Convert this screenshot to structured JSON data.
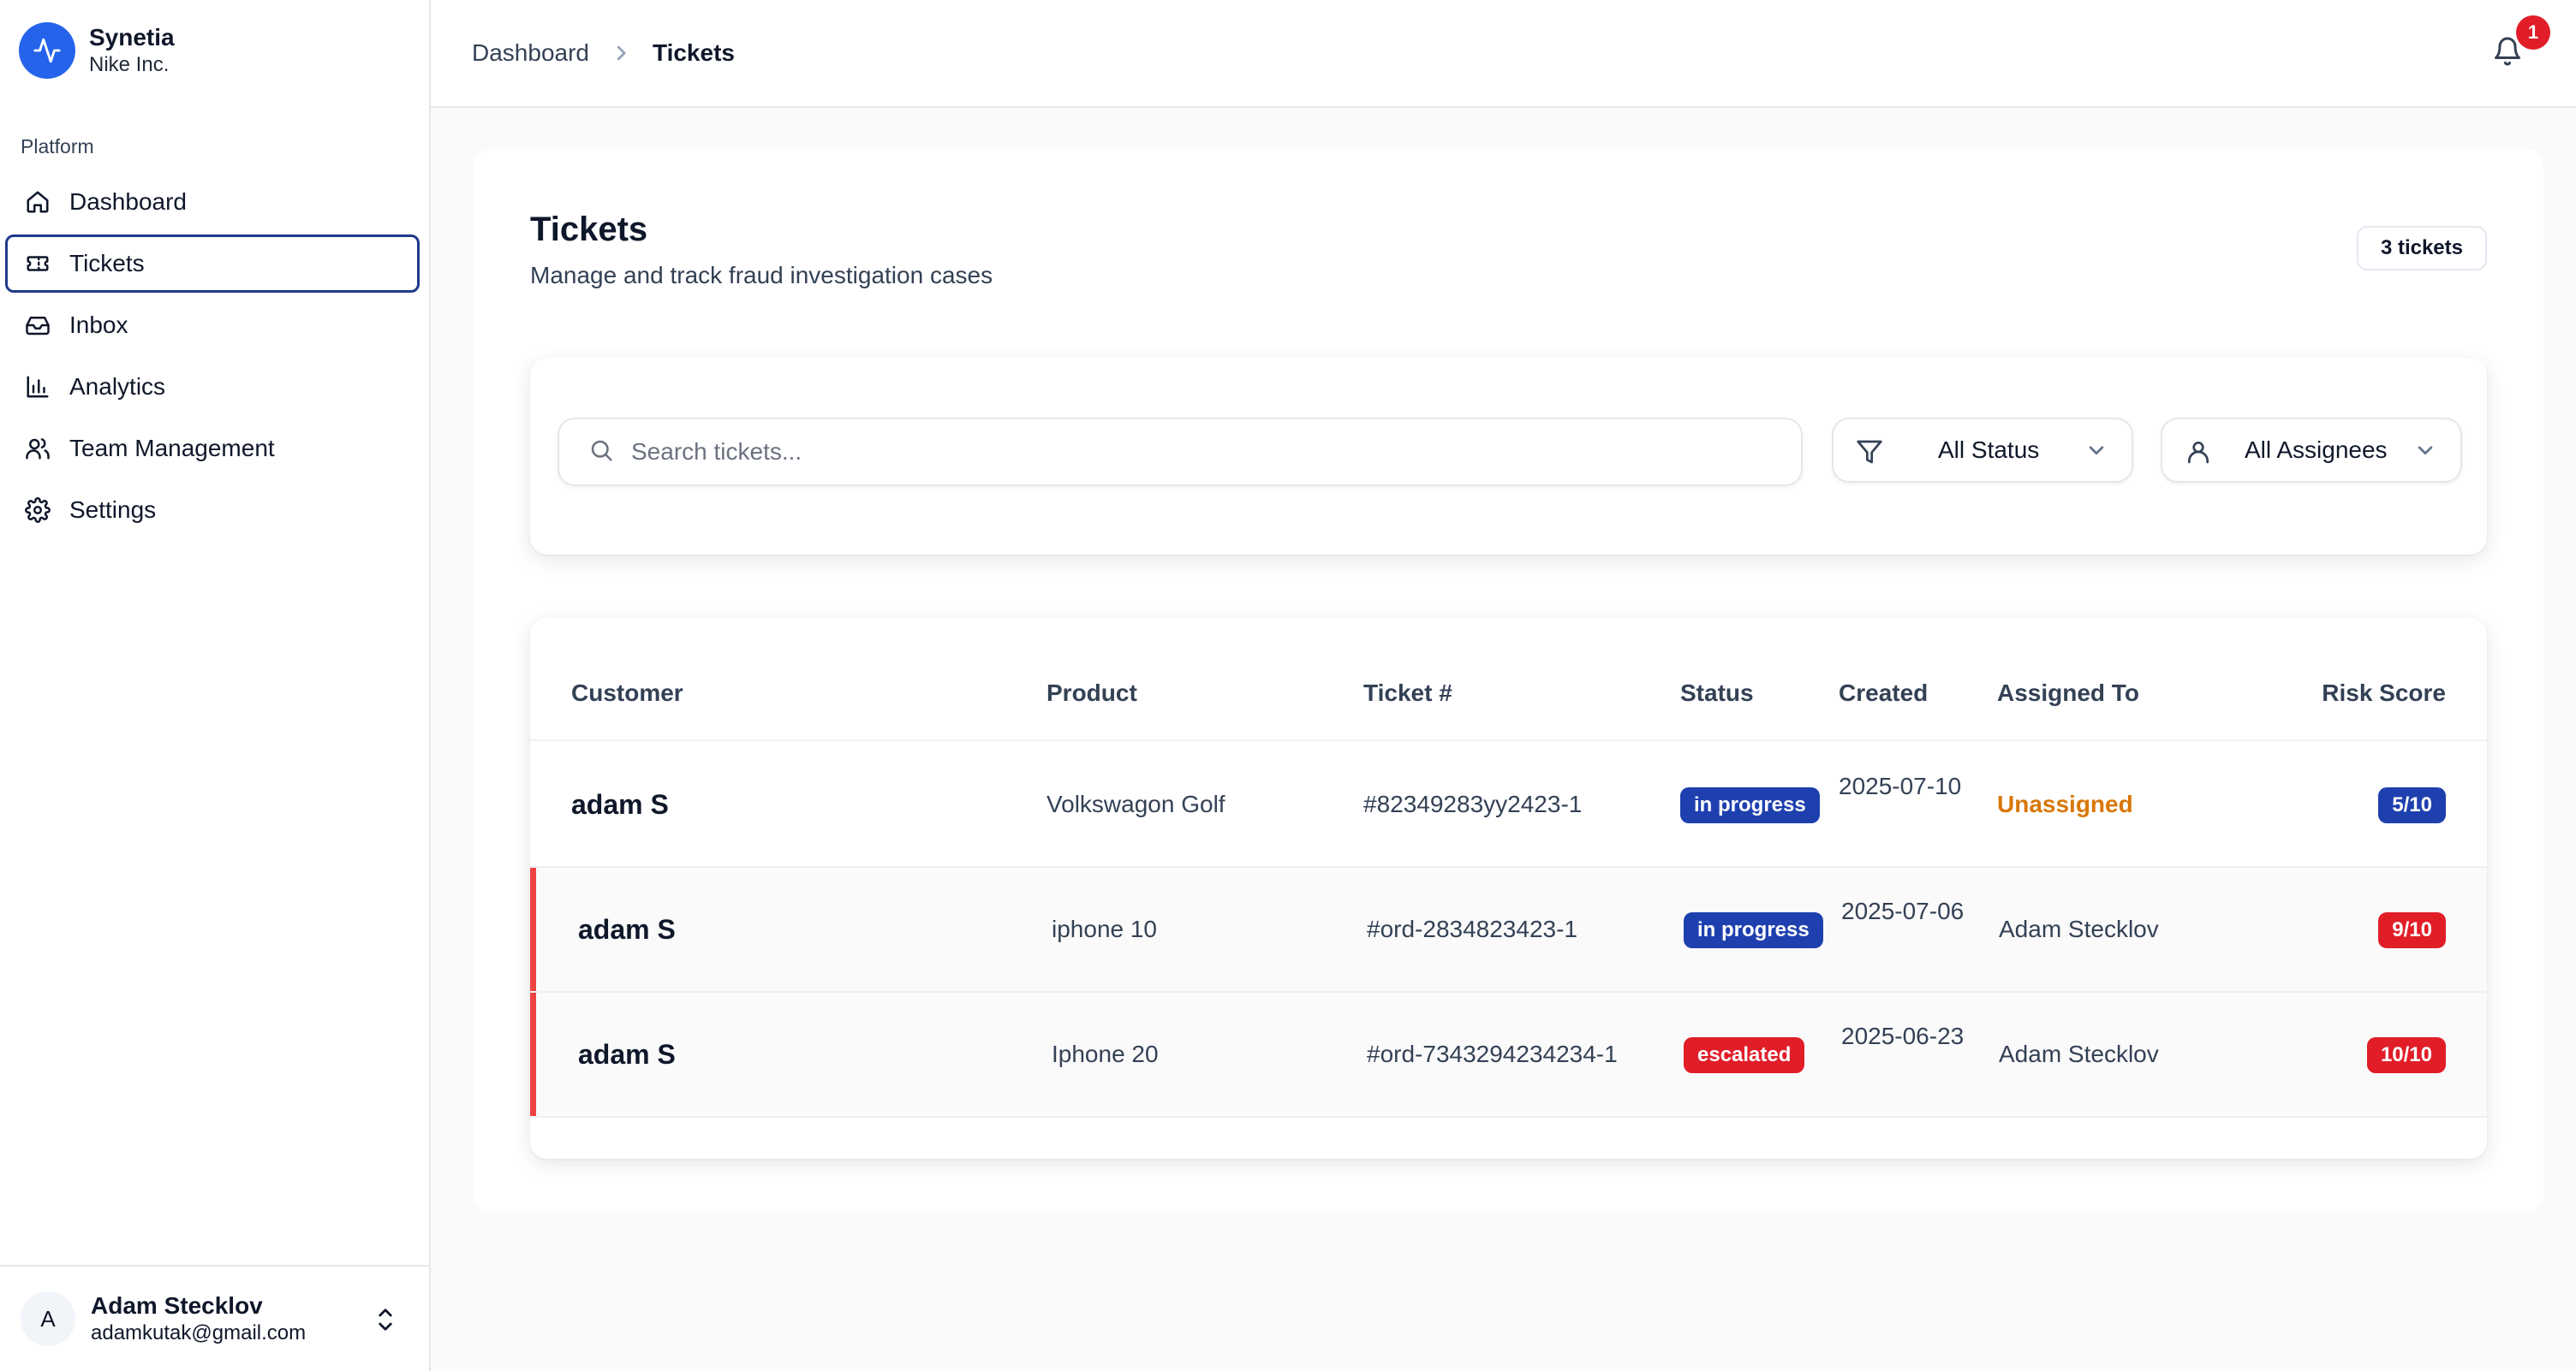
{
  "brand": {
    "name": "Synetia",
    "org": "Nike Inc.",
    "accent": "#2563eb"
  },
  "sidebar": {
    "section_label": "Platform",
    "items": [
      {
        "label": "Dashboard",
        "icon": "home-icon",
        "active": false
      },
      {
        "label": "Tickets",
        "icon": "ticket-icon",
        "active": true
      },
      {
        "label": "Inbox",
        "icon": "inbox-icon",
        "active": false
      },
      {
        "label": "Analytics",
        "icon": "bar-chart-icon",
        "active": false
      },
      {
        "label": "Team Management",
        "icon": "users-icon",
        "active": false
      },
      {
        "label": "Settings",
        "icon": "gear-icon",
        "active": false
      }
    ],
    "user": {
      "initial": "A",
      "name": "Adam Stecklov",
      "email": "adamkutak@gmail.com"
    }
  },
  "header": {
    "breadcrumb": [
      "Dashboard",
      "Tickets"
    ],
    "notifications_count": "1"
  },
  "page": {
    "title": "Tickets",
    "subtitle": "Manage and track fraud investigation cases",
    "count_label": "3 tickets"
  },
  "filters": {
    "search_placeholder": "Search tickets...",
    "search_value": "",
    "status_selected": "All Status",
    "assignee_selected": "All Assignees"
  },
  "table": {
    "columns": [
      "Customer",
      "Product",
      "Ticket #",
      "Status",
      "Created",
      "Assigned To",
      "Risk Score"
    ],
    "rows": [
      {
        "customer": "adam S",
        "product": "Volkswagon Golf",
        "ticket": "#82349283yy2423-1",
        "status": "in progress",
        "created": "2025-07-10",
        "assigned_to": "Unassigned",
        "risk_score": "5/10",
        "flagged": false
      },
      {
        "customer": "adam S",
        "product": "iphone 10",
        "ticket": "#ord-2834823423-1",
        "status": "in progress",
        "created": "2025-07-06",
        "assigned_to": "Adam Stecklov",
        "risk_score": "9/10",
        "flagged": true
      },
      {
        "customer": "adam S",
        "product": "Iphone 20",
        "ticket": "#ord-7343294234234-1",
        "status": "escalated",
        "created": "2025-06-23",
        "assigned_to": "Adam Stecklov",
        "risk_score": "10/10",
        "flagged": true
      }
    ]
  },
  "colors": {
    "in_progress": "#1e40af",
    "escalated": "#e11d28",
    "risk_medium": "#1e40af",
    "risk_high": "#e11d28",
    "unassigned": "#d97706"
  }
}
